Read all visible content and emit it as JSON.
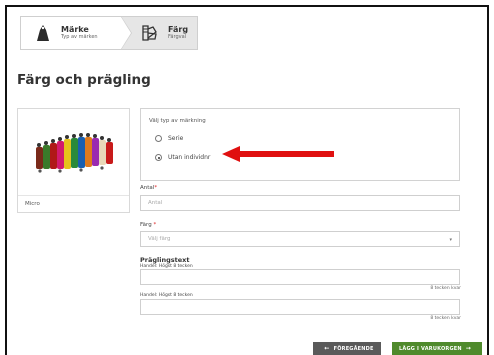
{
  "steps": [
    {
      "title": "Märke",
      "subtitle": "Typ av märken",
      "icon": "tag-icon"
    },
    {
      "title": "Färg",
      "subtitle": "Färgval",
      "icon": "color-swatch-icon"
    }
  ],
  "page_title": "Färg och prägling",
  "product": {
    "name": "Micro",
    "image_icon": "colored-ear-tags-image"
  },
  "marking": {
    "label": "Välj typ av märkning",
    "options": [
      {
        "label": "Serie",
        "selected": false
      },
      {
        "label": "Utan individnr",
        "selected": true
      }
    ]
  },
  "form": {
    "antal_label": "Antal",
    "antal_placeholder": "Antal",
    "farg_label": "Färg",
    "farg_placeholder": "Välj färg",
    "pragling_title": "Präglingstext",
    "line1_label": "Handel: Högst 8 tecken",
    "line1_hint": "8 tecken kvar",
    "line2_label": "Handel: Högst 8 tecken",
    "line2_hint": "8 tecken kvar",
    "required_mark": "*"
  },
  "buttons": {
    "prev_label": "FÖREGÅENDE",
    "next_label": "LÄGG I VARUKORGEN"
  },
  "colors": {
    "accent_green": "#4f8a2c",
    "button_gray": "#5a5a5a",
    "annotation_red": "#e01010",
    "required_red": "#dd2222"
  }
}
